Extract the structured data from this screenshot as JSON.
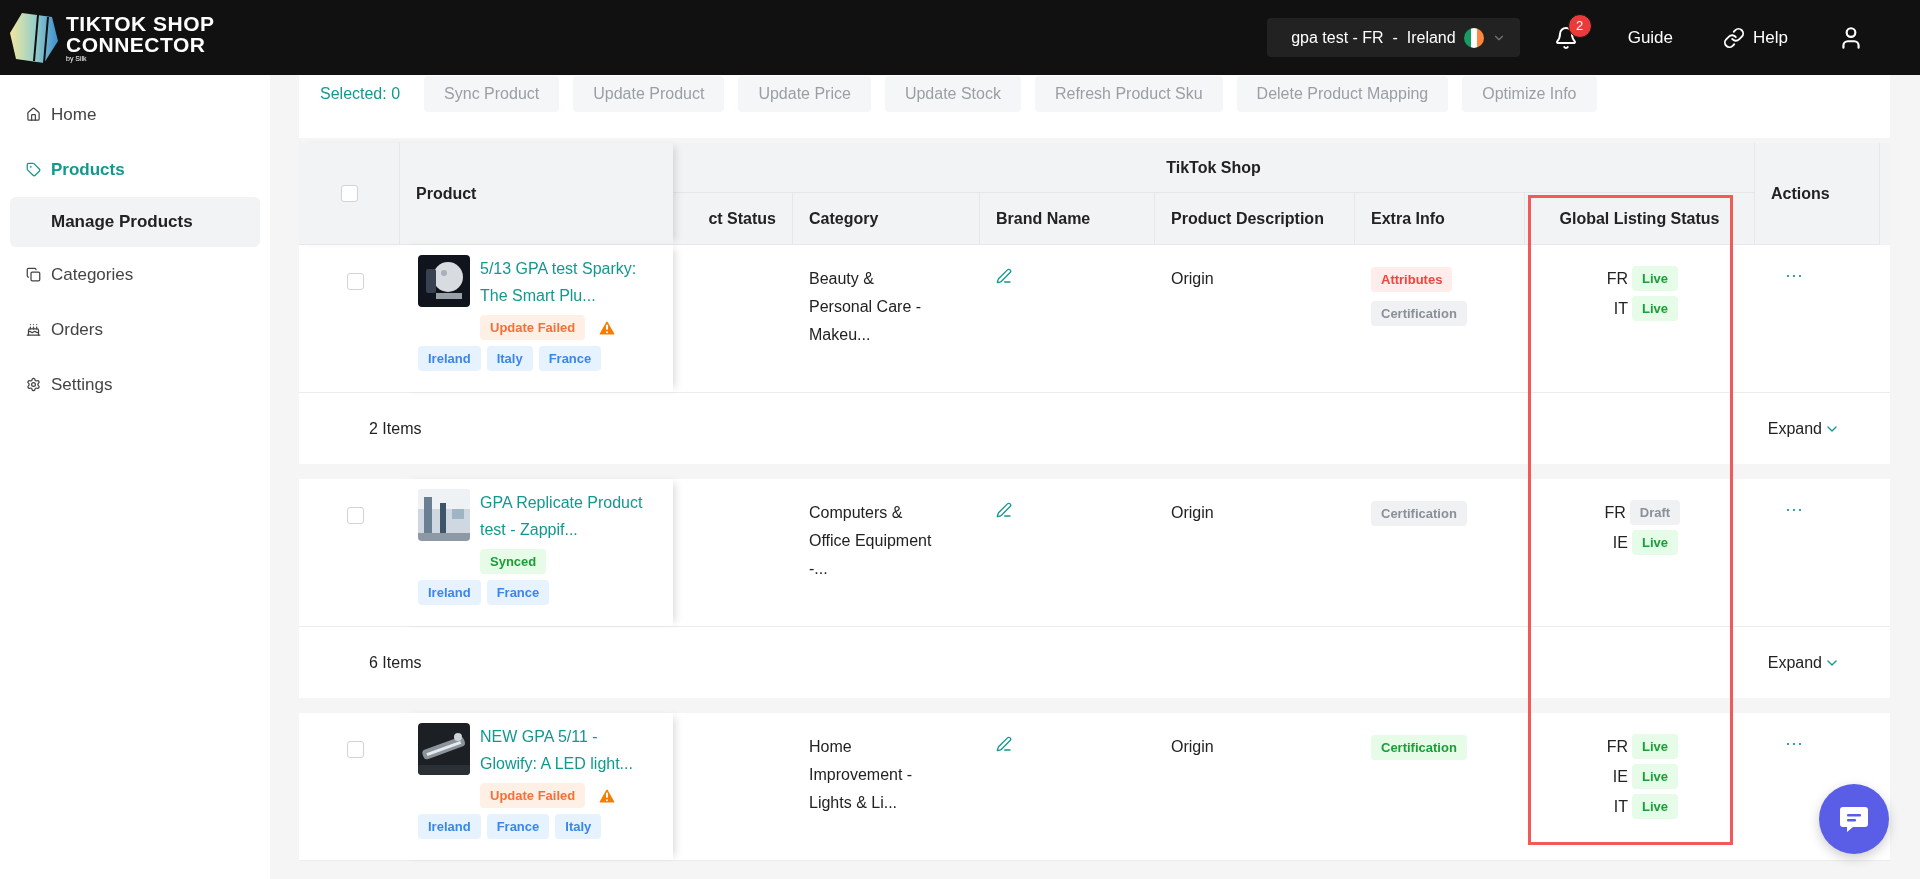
{
  "header": {
    "brand_line1": "TIKTOK SHOP",
    "brand_line2": "CONNECTOR",
    "brand_byline": "by Silk",
    "store": "gpa test - FR  -  Ireland",
    "notifications": "2",
    "nav": [
      {
        "label": "Guide",
        "kind": "text"
      },
      {
        "label": "Help",
        "kind": "link"
      }
    ]
  },
  "sidebar": {
    "items": [
      {
        "label": "Home",
        "kind": "home",
        "selected": false
      },
      {
        "label": "Products",
        "kind": "tag",
        "selected": true,
        "children": [
          {
            "label": "Manage Products",
            "selected": true
          }
        ]
      },
      {
        "label": "Categories",
        "kind": "copy",
        "selected": false
      },
      {
        "label": "Orders",
        "kind": "orders",
        "selected": false
      },
      {
        "label": "Settings",
        "kind": "settings",
        "selected": false
      }
    ]
  },
  "toolbar": {
    "selected_label": "Selected: 0",
    "buttons": [
      {
        "label": "Sync Product",
        "disabled": true
      },
      {
        "label": "Update Product",
        "disabled": true
      },
      {
        "label": "Update Price",
        "disabled": true
      },
      {
        "label": "Update Stock",
        "disabled": true
      },
      {
        "label": "Refresh Product Sku",
        "disabled": true
      },
      {
        "label": "Delete Product Mapping",
        "disabled": true
      },
      {
        "label": "Optimize Info",
        "disabled": true
      }
    ]
  },
  "table": {
    "header_checked": false,
    "product_column": "Product",
    "group_title": "TikTok Shop",
    "group_columns": [
      "ct Status",
      "Category",
      "Brand Name",
      "Product Description",
      "Extra Info",
      "Global Listing Status"
    ],
    "actions_column": "Actions",
    "rows": [
      {
        "checked": false,
        "title": "5/13 GPA test Sparky: The Smart Plu...",
        "status": {
          "label": "Update Failed",
          "kind": "failed"
        },
        "warning": true,
        "regions": [
          "Ireland",
          "Italy",
          "France"
        ],
        "category": "Beauty & Personal Care - Makeu...",
        "description": "Origin",
        "extra_info": [
          {
            "label": "Attributes",
            "kind": "error"
          },
          {
            "label": "Certification",
            "kind": "neutral"
          }
        ],
        "listings": [
          {
            "market": "FR",
            "status": "Live",
            "kind": "live"
          },
          {
            "market": "IT",
            "status": "Live",
            "kind": "live"
          }
        ],
        "actions": "···",
        "summary": {
          "count": "2 Items",
          "expand": "Expand"
        }
      },
      {
        "checked": false,
        "title": "GPA Replicate Product test - Zappif...",
        "status": {
          "label": "Synced",
          "kind": "synced"
        },
        "warning": false,
        "regions": [
          "Ireland",
          "France"
        ],
        "category": "Computers & Office Equipment -...",
        "description": "Origin",
        "extra_info": [
          {
            "label": "Certification",
            "kind": "neutral"
          }
        ],
        "listings": [
          {
            "market": "FR",
            "status": "Draft",
            "kind": "draft"
          },
          {
            "market": "IE",
            "status": "Live",
            "kind": "live"
          }
        ],
        "actions": "···",
        "summary": {
          "count": "6 Items",
          "expand": "Expand"
        }
      },
      {
        "checked": false,
        "title": "NEW GPA 5/11 - Glowify: A LED light...",
        "status": {
          "label": "Update Failed",
          "kind": "failed"
        },
        "warning": true,
        "regions": [
          "Ireland",
          "France",
          "Italy"
        ],
        "category": "Home Improvement - Lights & Li...",
        "description": "Origin",
        "extra_info": [
          {
            "label": "Certification",
            "kind": "success"
          }
        ],
        "listings": [
          {
            "market": "FR",
            "status": "Live",
            "kind": "live"
          },
          {
            "market": "IE",
            "status": "Live",
            "kind": "live"
          },
          {
            "market": "IT",
            "status": "Live",
            "kind": "live"
          }
        ],
        "actions": "···"
      }
    ]
  }
}
